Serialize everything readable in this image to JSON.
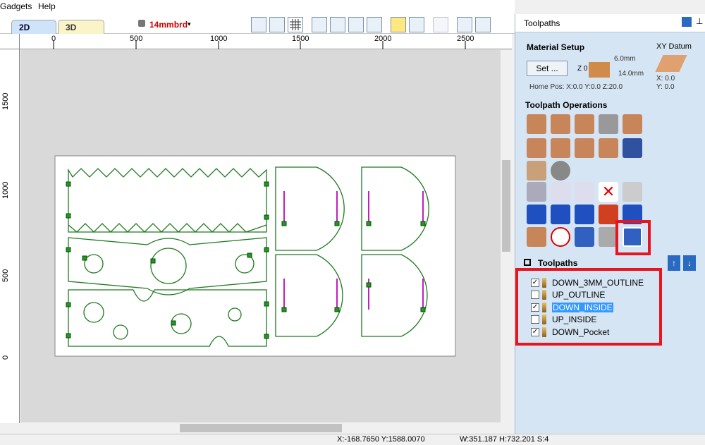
{
  "menu": {
    "items": [
      "Gadgets",
      "Help"
    ]
  },
  "view_tabs": {
    "active": "2D View",
    "inactive": "3D View"
  },
  "material_selector": "14mmbrd",
  "ruler": {
    "top_labels": [
      "0",
      "500",
      "1000",
      "1500",
      "2000",
      "2500"
    ],
    "left_labels": [
      "1500",
      "1000",
      "500",
      "0"
    ]
  },
  "status": {
    "coords": "X:-168.7650 Y:1588.0070",
    "size": "W:351.187  H:732.201  S:4"
  },
  "panel": {
    "title": "Toolpaths",
    "material_setup": {
      "title": "Material Setup",
      "set_button": "Set ...",
      "z_label": "Z 0",
      "thickness_top": "6.0mm",
      "thickness_bottom": "14.0mm",
      "home_pos": "Home Pos:  X:0.0 Y:0.0 Z:20.0",
      "xy_datum_title": "XY Datum",
      "x": "X: 0.0",
      "y": "Y: 0.0"
    },
    "operations_title": "Toolpath Operations",
    "list_title": "Toolpaths",
    "toolpaths": [
      {
        "name": "DOWN_3MM_OUTLINE",
        "checked": true,
        "selected": false
      },
      {
        "name": "UP_OUTLINE",
        "checked": false,
        "selected": false
      },
      {
        "name": "DOWN_INSIDE",
        "checked": true,
        "selected": true
      },
      {
        "name": "UP_INSIDE",
        "checked": false,
        "selected": false
      },
      {
        "name": "DOWN_Pocket",
        "checked": true,
        "selected": false
      }
    ],
    "check_mark": "✓"
  },
  "colors": {
    "highlight_red": "#e8141e",
    "vector_green": "#1e7a1e",
    "toolpath_magenta": "#c020c0",
    "selection_blue": "#3399ff"
  }
}
